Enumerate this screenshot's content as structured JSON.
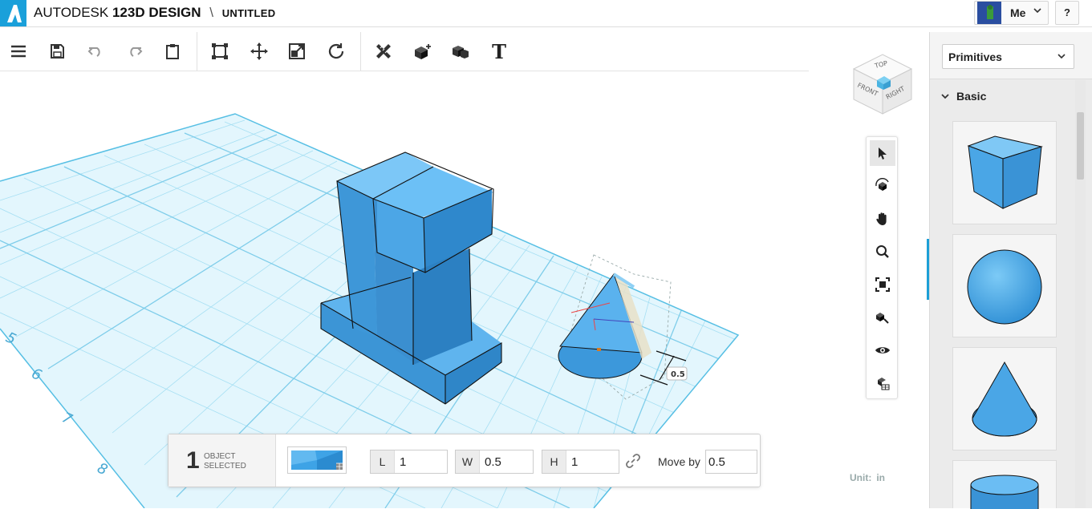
{
  "app": {
    "brand": "AUTODESK",
    "product": "123D",
    "product_suffix": "DESIGN",
    "separator": "\\",
    "document": "UNTITLED"
  },
  "user": {
    "name": "Me",
    "help": "?"
  },
  "toolbar": {
    "items": [
      "menu-icon",
      "save-icon",
      "undo-icon",
      "redo-icon",
      "clipboard-icon",
      "smart-scale-icon",
      "move-icon",
      "scale-icon",
      "refresh-icon",
      "measure-icon",
      "primitive-icon",
      "combine-icon",
      "text-icon"
    ],
    "text_glyph": "T"
  },
  "viewcube": {
    "top": "TOP",
    "front": "FRONT",
    "right": "RIGHT"
  },
  "grid": {
    "labels": [
      "5",
      "6",
      "7",
      "8"
    ]
  },
  "dimension": {
    "value": "0.5"
  },
  "navbar": {
    "items": [
      "select-icon",
      "orbit-icon",
      "pan-icon",
      "zoom-icon",
      "fit-icon",
      "zoom-selected-icon",
      "visibility-icon",
      "material-icon"
    ]
  },
  "unit": {
    "label": "Unit:",
    "value": "in"
  },
  "selection": {
    "count": "1",
    "label": "OBJECT SELECTED",
    "length_label": "L",
    "length": "1",
    "width_label": "W",
    "width": "0.5",
    "height_label": "H",
    "height": "1",
    "moveby_label": "Move by",
    "moveby": "0.5"
  },
  "panel": {
    "dropdown": "Primitives",
    "section": "Basic",
    "items": [
      "cube",
      "sphere",
      "cone",
      "cylinder"
    ]
  },
  "colors": {
    "accent": "#1aa0da",
    "model": "#4aa6e6",
    "grid": "#d9f2fa"
  }
}
